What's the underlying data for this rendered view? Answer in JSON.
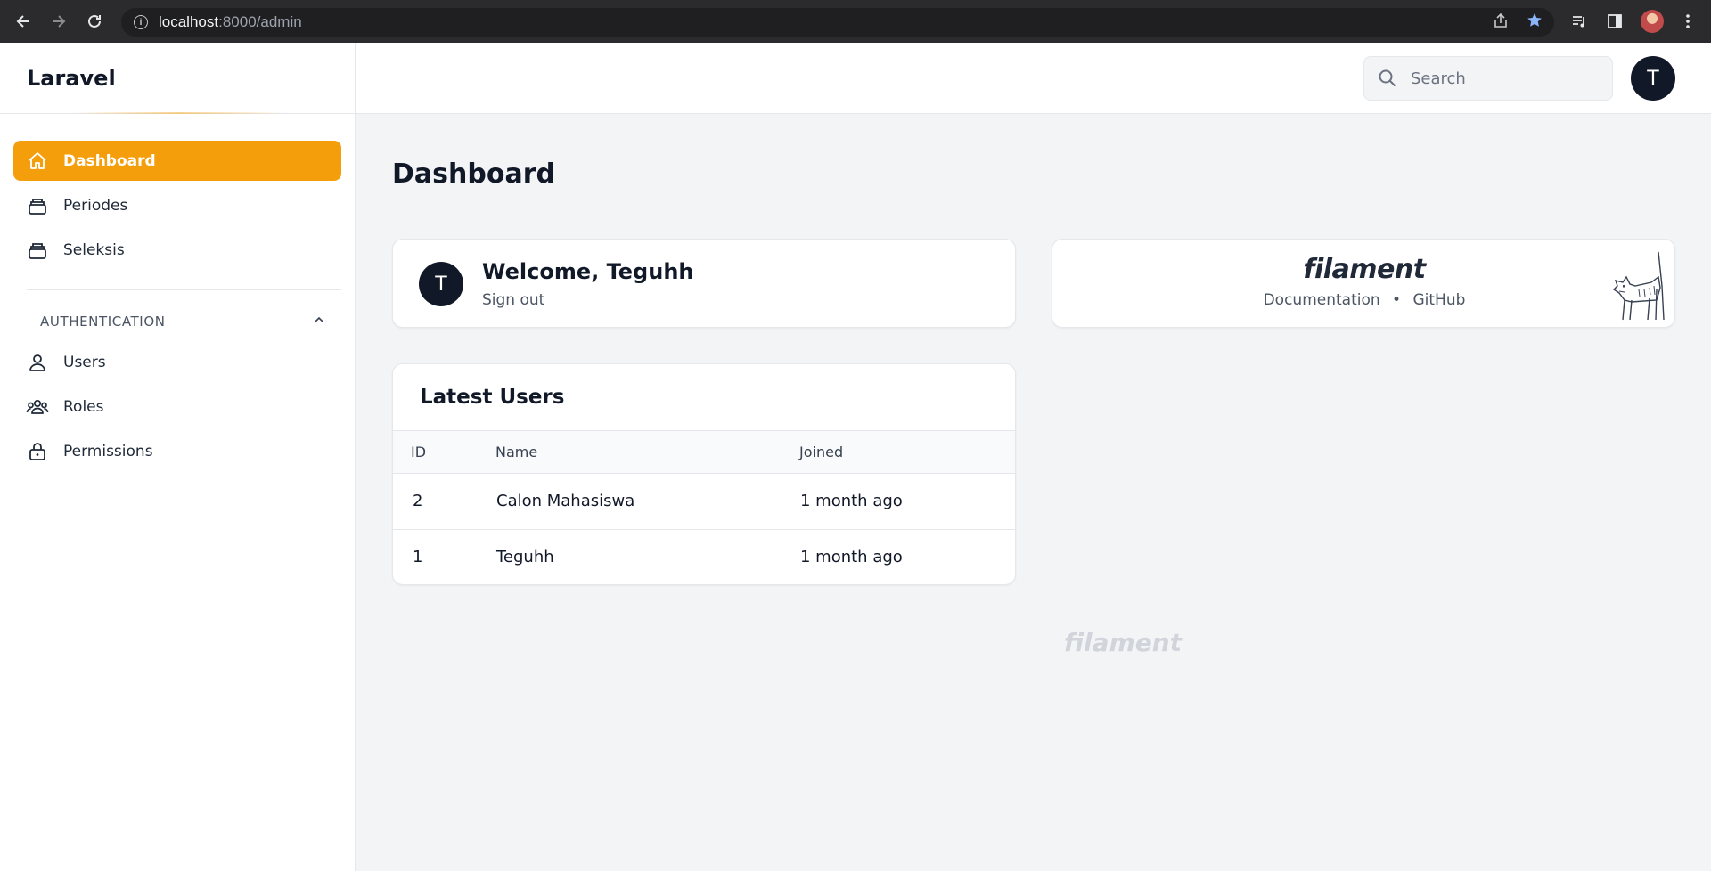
{
  "browser": {
    "url_host": "localhost",
    "url_path": ":8000/admin"
  },
  "sidebar": {
    "brand": "Laravel",
    "items": [
      {
        "label": "Dashboard",
        "icon": "home-icon",
        "active": true
      },
      {
        "label": "Periodes",
        "icon": "collection-icon"
      },
      {
        "label": "Seleksis",
        "icon": "collection-icon"
      }
    ],
    "group": {
      "label": "AUTHENTICATION",
      "items": [
        {
          "label": "Users",
          "icon": "user-icon"
        },
        {
          "label": "Roles",
          "icon": "user-group-icon"
        },
        {
          "label": "Permissions",
          "icon": "lock-icon"
        }
      ]
    }
  },
  "topbar": {
    "search_placeholder": "Search",
    "avatar_initial": "T"
  },
  "main": {
    "title": "Dashboard",
    "welcome": {
      "avatar_initial": "T",
      "greeting": "Welcome, Teguhh",
      "signout": "Sign out"
    },
    "filament": {
      "logo": "filament",
      "documentation": "Documentation",
      "separator": "•",
      "github": "GitHub"
    },
    "latest_users": {
      "title": "Latest Users",
      "columns": [
        "ID",
        "Name",
        "Joined"
      ],
      "rows": [
        {
          "id": "2",
          "name": "Calon Mahasiswa",
          "joined": "1 month ago"
        },
        {
          "id": "1",
          "name": "Teguhh",
          "joined": "1 month ago"
        }
      ]
    },
    "footer_logo": "filament"
  },
  "colors": {
    "accent": "#f59e0b",
    "dark": "#111827",
    "background": "#f3f4f6"
  }
}
